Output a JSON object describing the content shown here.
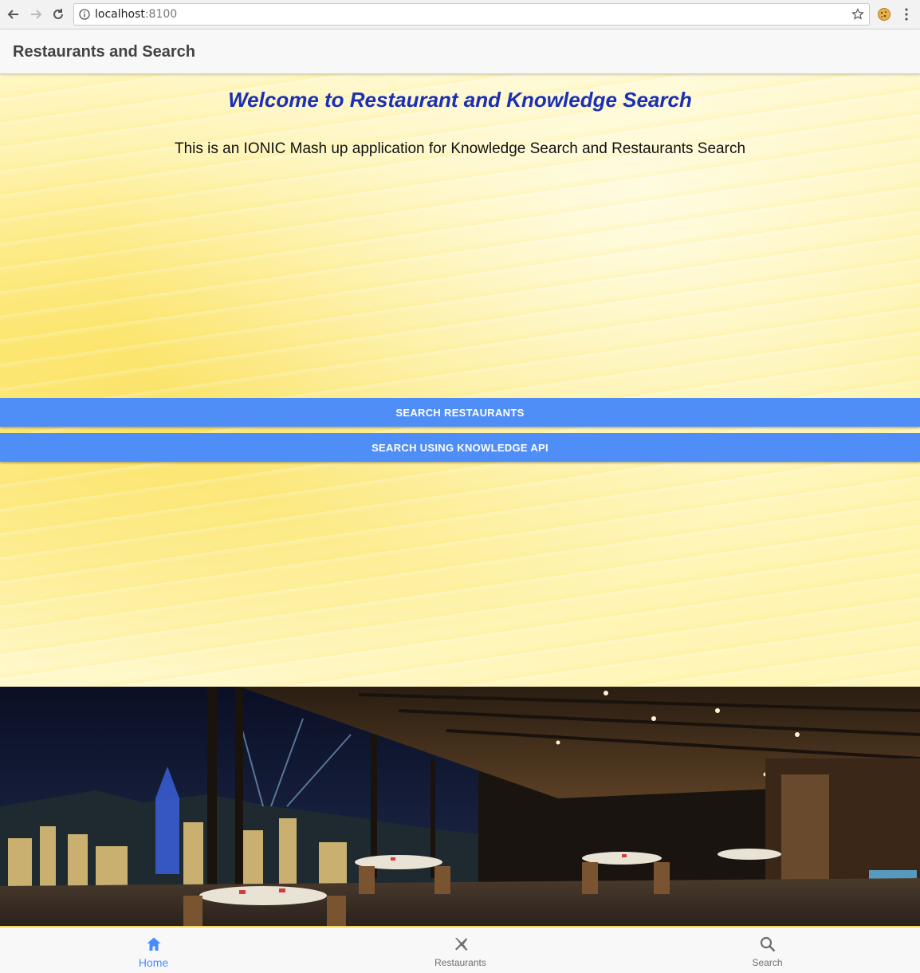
{
  "browser": {
    "url_host": "localhost",
    "url_port": ":8100"
  },
  "toolbar": {
    "title": "Restaurants and Search"
  },
  "main": {
    "welcome": "Welcome to Restaurant and Knowledge Search",
    "subtitle": "This is an IONIC Mash up application for Knowledge Search and Restaurants Search",
    "buttons": [
      {
        "label": "SEARCH RESTAURANTS"
      },
      {
        "label": "SEARCH USING KNOWLEDGE API"
      }
    ]
  },
  "tabs": [
    {
      "label": "Home",
      "icon": "home-icon",
      "active": true
    },
    {
      "label": "Restaurants",
      "icon": "restaurant-icon",
      "active": false
    },
    {
      "label": "Search",
      "icon": "search-icon",
      "active": false
    }
  ],
  "colors": {
    "accent": "#488aff",
    "button": "#4f8ef7",
    "welcome_text": "#1a2fb5"
  }
}
